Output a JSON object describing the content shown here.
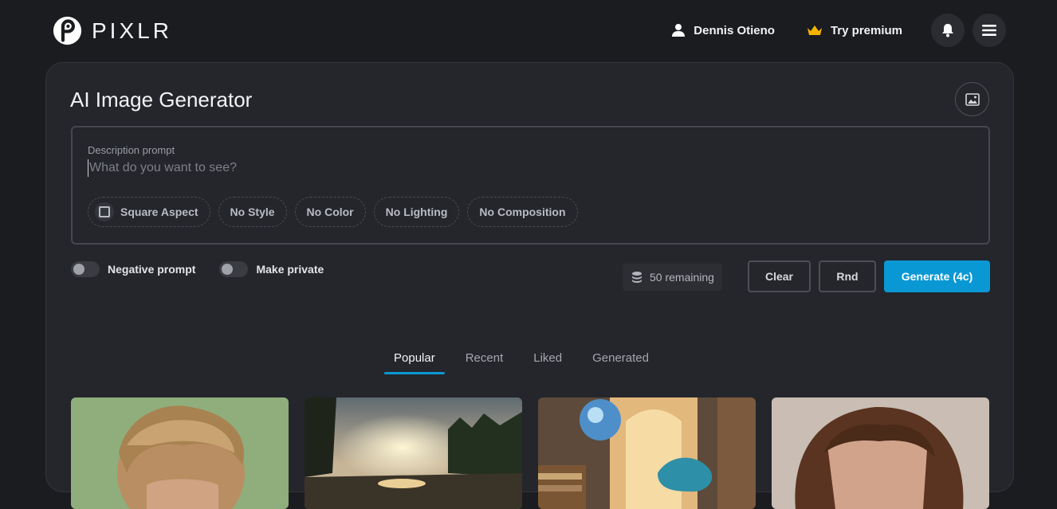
{
  "brand": {
    "logo_text": "PIXLR",
    "logo_icon": "pixlr-logo-icon"
  },
  "header": {
    "user_name": "Dennis Otieno",
    "user_icon": "user-icon",
    "premium_label": "Try premium",
    "premium_icon": "crown-icon",
    "premium_color": "#f5b400",
    "notifications_icon": "bell-icon",
    "menu_icon": "hamburger-icon"
  },
  "generator": {
    "title": "AI Image Generator",
    "image_button_icon": "image-icon",
    "prompt_label": "Description prompt",
    "prompt_value": "",
    "prompt_placeholder": "What do you want to see?",
    "chips": {
      "square": "Square Aspect",
      "style": "No Style",
      "color": "No Color",
      "lighting": "No Lighting",
      "composition": "No Composition"
    },
    "toggles": {
      "negative": {
        "label": "Negative prompt",
        "on": false
      },
      "private": {
        "label": "Make private",
        "on": false
      }
    },
    "credits": {
      "text": "50 remaining",
      "icon": "coins-icon"
    },
    "buttons": {
      "clear": "Clear",
      "rnd": "Rnd",
      "generate": "Generate (4c)"
    },
    "accent_color": "#0a98d4"
  },
  "tabs": {
    "popular": "Popular",
    "recent": "Recent",
    "liked": "Liked",
    "generated": "Generated",
    "active": "Popular"
  },
  "gallery": [
    {
      "subject": "blond-man-portrait"
    },
    {
      "subject": "forest-lake-sunset"
    },
    {
      "subject": "fantasy-library-dragon"
    },
    {
      "subject": "curly-hair-portrait"
    }
  ]
}
